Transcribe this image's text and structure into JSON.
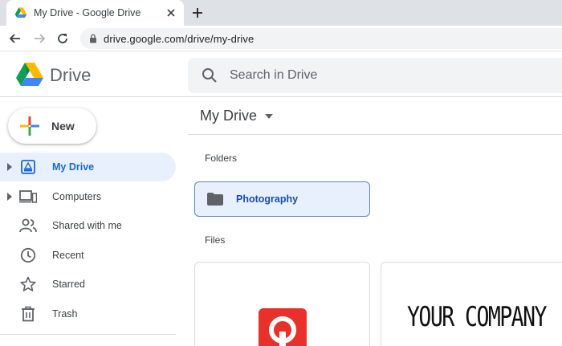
{
  "browser": {
    "tab_title": "My Drive - Google Drive",
    "url": "drive.google.com/drive/my-drive"
  },
  "header": {
    "product_name": "Drive",
    "search_placeholder": "Search in Drive"
  },
  "sidebar": {
    "new_label": "New",
    "items": [
      {
        "label": "My Drive",
        "icon": "my-drive-icon",
        "active": true
      },
      {
        "label": "Computers",
        "icon": "computers-icon"
      },
      {
        "label": "Shared with me",
        "icon": "people-icon"
      },
      {
        "label": "Recent",
        "icon": "clock-icon"
      },
      {
        "label": "Starred",
        "icon": "star-icon"
      },
      {
        "label": "Trash",
        "icon": "trash-icon"
      }
    ]
  },
  "main": {
    "title": "My Drive",
    "folders_label": "Folders",
    "files_label": "Files",
    "folders": [
      {
        "name": "Photography"
      }
    ],
    "files": [
      {
        "preview": "red-app-icon"
      },
      {
        "preview_text": "YOUR COMPANY"
      }
    ]
  },
  "colors": {
    "active_bg": "#e8f0fe",
    "active_text": "#1967d2",
    "search_bg": "#f1f3f4",
    "tabstrip_bg": "#dee1e6",
    "brand_red": "#e8312b"
  }
}
